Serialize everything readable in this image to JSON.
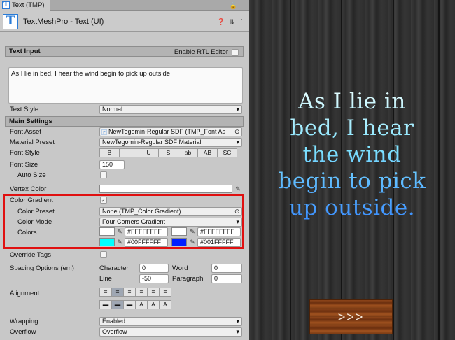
{
  "tab": {
    "title": "Text (TMP)"
  },
  "component": {
    "title": "TextMeshPro - Text (UI)"
  },
  "text_input": {
    "header": "Text Input",
    "rtl_label": "Enable RTL Editor",
    "value": "As I lie in bed, I hear the wind begin to pick up outside."
  },
  "text_style": {
    "label": "Text Style",
    "value": "Normal"
  },
  "main_settings": {
    "header": "Main Settings"
  },
  "font_asset": {
    "label": "Font Asset",
    "value": "NewTegomin-Regular SDF (TMP_Font As"
  },
  "material_preset": {
    "label": "Material Preset",
    "value": "NewTegomin-Regular SDF Material"
  },
  "font_style": {
    "label": "Font Style",
    "buttons": [
      "B",
      "I",
      "U",
      "S",
      "ab",
      "AB",
      "SC"
    ]
  },
  "font_size": {
    "label": "Font Size",
    "value": "150"
  },
  "auto_size": {
    "label": "Auto Size"
  },
  "vertex_color": {
    "label": "Vertex Color"
  },
  "color_gradient": {
    "label": "Color Gradient",
    "checked": "✓"
  },
  "color_preset": {
    "label": "Color Preset",
    "value": "None (TMP_Color Gradient)"
  },
  "color_mode": {
    "label": "Color Mode",
    "value": "Four Corners Gradient"
  },
  "colors": {
    "label": "Colors",
    "top_left": {
      "hex": "#FFFFFFFF",
      "swatch": "#ffffff"
    },
    "top_right": {
      "hex": "#FFFFFFFF",
      "swatch": "#ffffff"
    },
    "bottom_left": {
      "hex": "#00FFFFFF",
      "swatch": "#00ffff"
    },
    "bottom_right": {
      "hex": "#001FFFFF",
      "swatch": "#001fff"
    }
  },
  "override_tags": {
    "label": "Override Tags"
  },
  "spacing": {
    "label": "Spacing Options (em)",
    "character_label": "Character",
    "character_value": "0",
    "word_label": "Word",
    "word_value": "0",
    "line_label": "Line",
    "line_value": "-50",
    "paragraph_label": "Paragraph",
    "paragraph_value": "0"
  },
  "alignment": {
    "label": "Alignment"
  },
  "wrapping": {
    "label": "Wrapping",
    "value": "Enabled"
  },
  "overflow": {
    "label": "Overflow",
    "value": "Overflow"
  },
  "scene": {
    "text_lines": [
      "As I lie in",
      "bed, I hear",
      "the wind",
      "begin to pick",
      "up outside."
    ],
    "button_label": ">>>"
  }
}
